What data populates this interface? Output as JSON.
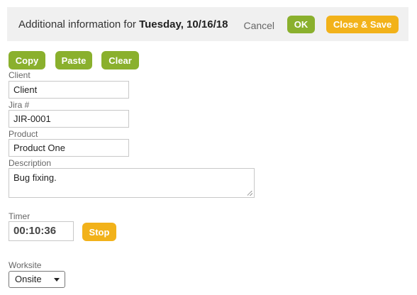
{
  "header": {
    "title_prefix": "Additional information for ",
    "title_date": "Tuesday, 10/16/18",
    "cancel_label": "Cancel",
    "ok_label": "OK",
    "close_save_label": "Close & Save"
  },
  "toolbar": {
    "copy_label": "Copy",
    "paste_label": "Paste",
    "clear_label": "Clear"
  },
  "form": {
    "client": {
      "label": "Client",
      "value": "Client"
    },
    "jira": {
      "label": "Jira #",
      "value": "JIR-0001"
    },
    "product": {
      "label": "Product",
      "value": "Product One"
    },
    "description": {
      "label": "Description",
      "value": "Bug fixing."
    },
    "timer": {
      "label": "Timer",
      "value": "00:10:36",
      "stop_label": "Stop"
    },
    "worksite": {
      "label": "Worksite",
      "selected": "Onsite"
    }
  },
  "colors": {
    "green_button": "#8ab02d",
    "orange_button": "#f2b21a",
    "header_bg": "#f0f0f0"
  }
}
